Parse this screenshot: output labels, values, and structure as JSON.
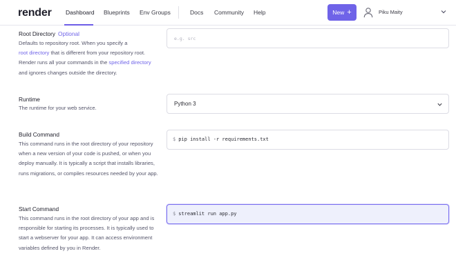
{
  "header": {
    "logo": "render",
    "nav": [
      {
        "label": "Dashboard"
      },
      {
        "label": "Blueprints"
      },
      {
        "label": "Env Groups"
      },
      {
        "label": "Docs"
      },
      {
        "label": "Community"
      },
      {
        "label": "Help"
      }
    ],
    "new_button_label": "New",
    "new_button_icon": "+",
    "user_name": "Piku Maity"
  },
  "root_directory": {
    "label": "Root Directory",
    "optional": "Optional",
    "desc_1": "Defaults to repository root. When you specify a",
    "desc_link_1": "root directory",
    "desc_2": " that is different from your repository root.",
    "desc_3": "Render runs all your commands in the ",
    "desc_link_2": "specified directory",
    "desc_4": "and ignores changes outside the directory.",
    "placeholder": "e.g. src"
  },
  "runtime": {
    "label": "Runtime",
    "desc": "The runtime for your web service.",
    "value": "Python 3"
  },
  "build_command": {
    "label": "Build Command",
    "desc": "This command runs in the root directory of your repository when a new version of your code is pushed, or when you deploy manually. It is typically a script that installs libraries, runs migrations, or compiles resources needed by your app.",
    "prompt": "$",
    "value": "pip install -r requirements.txt"
  },
  "start_command": {
    "label": "Start Command",
    "desc": "This command runs in the root directory of your app and is responsible for starting its processes. It is typically used to start a webserver for your app. It can access environment variables defined by you in Render.",
    "prompt": "$",
    "value": "streamlit run app.py"
  },
  "colors": {
    "accent": "#6f63e8",
    "focus_bg": "#eef0fc"
  }
}
